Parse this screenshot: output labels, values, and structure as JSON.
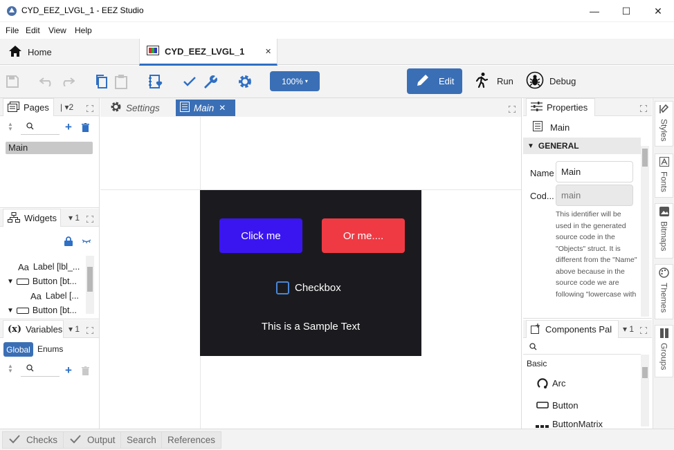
{
  "window": {
    "title": "CYD_EEZ_LVGL_1 - EEZ Studio",
    "minimize": "—",
    "maximize": "☐",
    "close": "✕"
  },
  "menu": [
    "File",
    "Edit",
    "View",
    "Help"
  ],
  "tabs": {
    "home": "Home",
    "project": "CYD_EEZ_LVGL_1",
    "project_close": "✕"
  },
  "toolbar": {
    "zoom": "100%",
    "zoom_caret": "▾",
    "edit": "Edit",
    "run": "Run",
    "debug": "Debug"
  },
  "pages": {
    "title": "Pages",
    "count": "2",
    "items": [
      "Main"
    ]
  },
  "widgets": {
    "title": "Widgets",
    "count": "1",
    "tree": [
      {
        "icon": "Aa",
        "label": "Label [lbl_..."
      },
      {
        "icon": "btn",
        "label": "Button [bt..."
      },
      {
        "icon": "Aa",
        "label": "Label [..."
      },
      {
        "icon": "btn",
        "label": "Button [bt..."
      }
    ]
  },
  "variables": {
    "title": "Variables",
    "count": "1",
    "tab_global": "Global",
    "tab_enums": "Enums"
  },
  "editor": {
    "tab_settings": "Settings",
    "tab_main": "Main",
    "tab_close": "✕"
  },
  "screen": {
    "button1": "Click me",
    "button2": "Or me....",
    "checkbox": "Checkbox",
    "sample_text": "This is a Sample Text",
    "colors": {
      "bg": "#1b1b1f",
      "button1": "#3b15f0",
      "button2": "#ef3a44"
    }
  },
  "properties": {
    "title": "Properties",
    "object": "Main",
    "section": "GENERAL",
    "name_label": "Name",
    "name_value": "Main",
    "code_label": "Cod...",
    "code_value": "main",
    "description": "This identifier will be used in the generated source code in the \"Objects\" struct. It is different from the \"Name\" above because in the source code we are following \"lowercase with"
  },
  "components": {
    "title": "Components Pal",
    "count": "1",
    "group": "Basic",
    "items": [
      "Arc",
      "Button",
      "ButtonMatrix"
    ]
  },
  "side_tabs": [
    "Styles",
    "Fonts",
    "Bitmaps",
    "Themes",
    "Groups"
  ],
  "bottom_tabs": [
    "Checks",
    "Output",
    "Search",
    "References"
  ],
  "colors": {
    "accent": "#3a6fb5",
    "icon_blue": "#2f6fc4"
  }
}
